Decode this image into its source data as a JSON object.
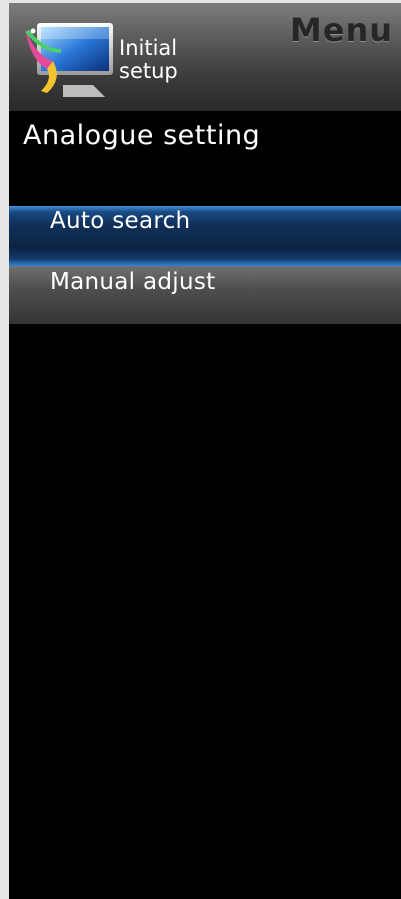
{
  "header": {
    "menu_title": "Menu",
    "setup_label_line1": "Initial",
    "setup_label_line2": "setup",
    "icon": "initial-setup-icon"
  },
  "section": {
    "title": "Analogue setting"
  },
  "menu": {
    "items": [
      {
        "label": "Auto search",
        "selected": true
      },
      {
        "label": "Manual adjust",
        "selected": false
      }
    ]
  },
  "colors": {
    "selected_highlight": "#2e86d8",
    "background": "#000000",
    "text": "#ffffff"
  }
}
